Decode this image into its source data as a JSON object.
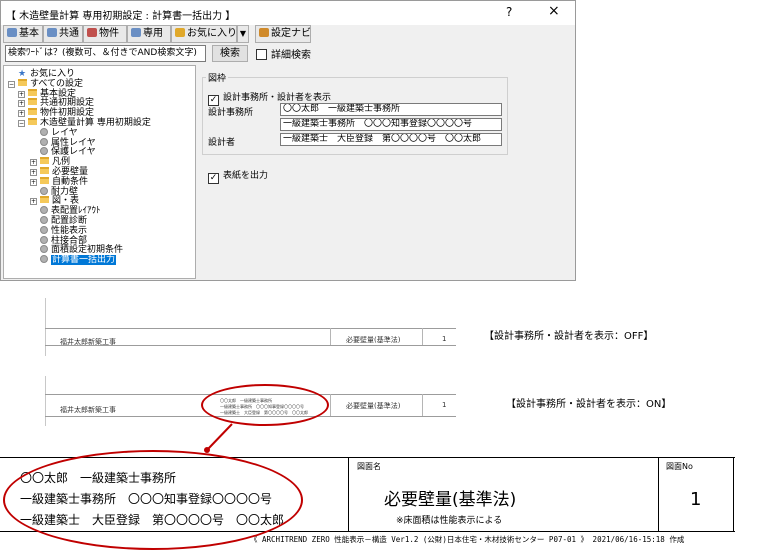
{
  "dialog": {
    "title": "【 木造壁量計算 専用初期設定 : 計算書一括出力 】",
    "help_glyph": "?",
    "close_glyph": "×",
    "toolbar": [
      {
        "label": "基本",
        "icon": "basic-icon",
        "color": "#6a8fc4"
      },
      {
        "label": "共通",
        "icon": "common-icon",
        "color": "#6a8fc4"
      },
      {
        "label": "物件",
        "icon": "property-icon",
        "color": "#c0504d"
      },
      {
        "label": "専用",
        "icon": "dedicated-icon",
        "color": "#6a8fc4"
      },
      {
        "label": "お気に入り",
        "icon": "favorite-icon",
        "color": "#e0a82a"
      },
      {
        "label": "設定ナビ",
        "icon": "navi-icon",
        "color": "#d08a2a"
      }
    ],
    "toolbar_arrow": "▼",
    "search": {
      "value": "検索ﾜｰﾄﾞは？(複数可、＆付きでAND検索文字)",
      "button": "検索",
      "advanced_label": "詳細検索",
      "advanced_checked": false
    },
    "tree": [
      {
        "label": "お気に入り",
        "kind": "star",
        "expander": ""
      },
      {
        "label": "すべての設定",
        "kind": "folder",
        "expander": "−"
      },
      {
        "label": "基本設定",
        "kind": "folder",
        "expander": "+"
      },
      {
        "label": "共通初期設定",
        "kind": "folder",
        "expander": "+"
      },
      {
        "label": "物件初期設定",
        "kind": "folder",
        "expander": "+"
      },
      {
        "label": "木造壁量計算 専用初期設定",
        "kind": "folder",
        "expander": "−"
      },
      {
        "label": "レイヤ",
        "kind": "leaf",
        "expander": ""
      },
      {
        "label": "属性レイヤ",
        "kind": "leaf",
        "expander": ""
      },
      {
        "label": "保護レイヤ",
        "kind": "leaf",
        "expander": ""
      },
      {
        "label": "凡例",
        "kind": "folder",
        "expander": "+"
      },
      {
        "label": "必要壁量",
        "kind": "folder",
        "expander": "+"
      },
      {
        "label": "自動条件",
        "kind": "folder",
        "expander": "+"
      },
      {
        "label": "耐力壁",
        "kind": "leaf",
        "expander": ""
      },
      {
        "label": "図・表",
        "kind": "folder",
        "expander": "+"
      },
      {
        "label": "表配置ﾚｲｱｳﾄ",
        "kind": "leaf",
        "expander": ""
      },
      {
        "label": "配置診断",
        "kind": "leaf",
        "expander": ""
      },
      {
        "label": "性能表示",
        "kind": "leaf",
        "expander": ""
      },
      {
        "label": "柱接合部",
        "kind": "leaf",
        "expander": ""
      },
      {
        "label": "面積設定初期条件",
        "kind": "leaf",
        "expander": ""
      },
      {
        "label": "計算書一括出力",
        "kind": "leaf",
        "expander": "",
        "selected": true
      }
    ],
    "panel": {
      "group_title": "図枠",
      "show_designer_label": "設計事務所・設計者を表示",
      "show_designer_checked": true,
      "office_label": "設計事務所",
      "office_line1": "〇〇太郎　一級建築士事務所",
      "office_line2": "一級建築士事務所　〇〇〇知事登録〇〇〇〇号",
      "designer_label": "設計者",
      "designer_value": "一級建築士　大臣登録　第〇〇〇〇号　〇〇太郎",
      "cover_label": "表紙を出力",
      "cover_checked": true,
      "check_glyph": "✓"
    }
  },
  "previews": {
    "off": {
      "left_text": "福井太郎新築工事",
      "center_text": "必要壁量(基準法)",
      "page": "1",
      "caption": "【設計事務所・設計者を表示：OFF】"
    },
    "on": {
      "left_text": "福井太郎新築工事",
      "center_text": "必要壁量(基準法)",
      "page": "1",
      "mini_lines": [
        "〇〇太郎　一級建築士事務所",
        "一級建築士事務所　〇〇〇知事登録〇〇〇〇号",
        "一級建築士　大臣登録　第〇〇〇〇号　〇〇太郎"
      ],
      "caption": "【設計事務所・設計者を表示：ON】"
    }
  },
  "titleblock": {
    "office_line1": "〇〇太郎　一級建築士事務所",
    "office_line2": "一級建築士事務所　〇〇〇知事登録〇〇〇〇号",
    "designer_line": "一級建築士　大臣登録　第〇〇〇〇号　〇〇太郎",
    "drawing_name_label": "図面名",
    "drawing_name": "必要壁量(基準法)",
    "note": "※床面積は性能表示による",
    "number_label": "図面No",
    "number": "1",
    "footer": "《 ARCHITREND ZERO 性能表示－構造 Ver1.2 (公財)日本住宅・木材技術センター P07-01 》  2021/06/16-15:18 作成"
  },
  "annotation_color": "#c00000"
}
